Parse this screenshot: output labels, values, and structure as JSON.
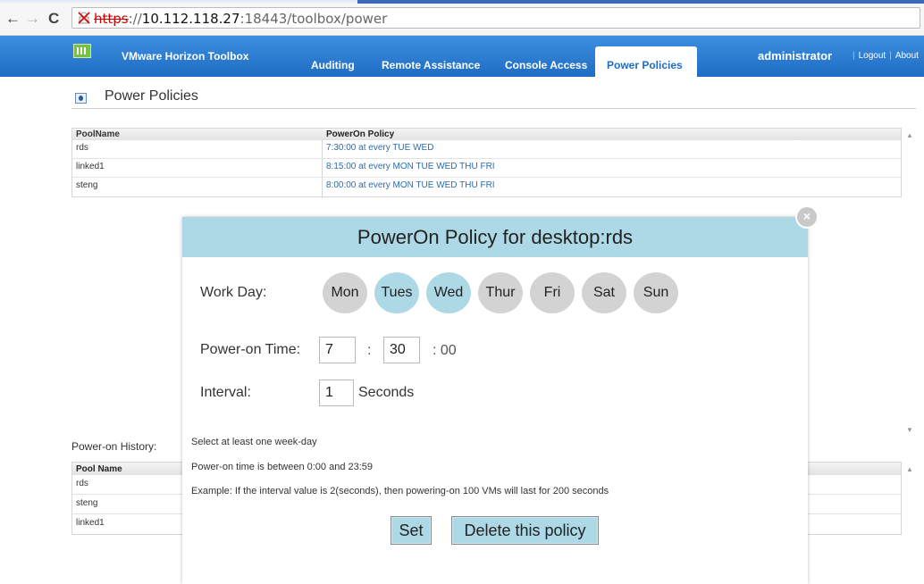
{
  "browser": {
    "back": "←",
    "forward": "→",
    "reload": "C",
    "url_scheme": "https",
    "url_sep": "://",
    "url_host": "10.112.118.27",
    "url_rest": ":18443/toolbox/power"
  },
  "app": {
    "brand": "VMware Horizon Toolbox",
    "menu": [
      "Auditing",
      "Remote Assistance",
      "Console Access",
      "Power Policies"
    ],
    "user": "administrator",
    "logout": "Logout",
    "about": "About"
  },
  "page": {
    "title": "Power Policies"
  },
  "policies": {
    "headers": [
      "PoolName",
      "PowerOn Policy"
    ],
    "rows": [
      [
        "rds",
        "7:30:00 at every TUE WED"
      ],
      [
        "linked1",
        "8:15:00 at every MON TUE WED THU FRI"
      ],
      [
        "steng",
        "8:00:00 at every MON TUE WED THU FRI"
      ]
    ]
  },
  "history": {
    "label": "Power-on History:",
    "header": "Pool Name",
    "rows": [
      "rds",
      "steng",
      "linked1"
    ]
  },
  "modal": {
    "title": "PowerOn Policy for desktop:rds",
    "close": "×",
    "workday_label": "Work Day:",
    "days": [
      {
        "label": "Mon",
        "selected": false
      },
      {
        "label": "Tues",
        "selected": true
      },
      {
        "label": "Wed",
        "selected": true
      },
      {
        "label": "Thur",
        "selected": false
      },
      {
        "label": "Fri",
        "selected": false
      },
      {
        "label": "Sat",
        "selected": false
      },
      {
        "label": "Sun",
        "selected": false
      }
    ],
    "time_label": "Power-on Time:",
    "hour": "7",
    "minute": "30",
    "colon": ":",
    "seconds_suffix": ": 00",
    "interval_label": "Interval:",
    "interval": "1",
    "interval_unit": "Seconds",
    "notes": [
      "Select at least one week-day",
      "Power-on time is between 0:00 and 23:59",
      "Example: If the interval value is 2(seconds), then powering-on 100 VMs will last for 200 seconds"
    ],
    "set_button": "Set",
    "delete_button": "Delete this policy"
  },
  "colors": {
    "accent": "#add8e6",
    "header_blue": "#1e6cc4",
    "link": "#2b6cb0"
  }
}
